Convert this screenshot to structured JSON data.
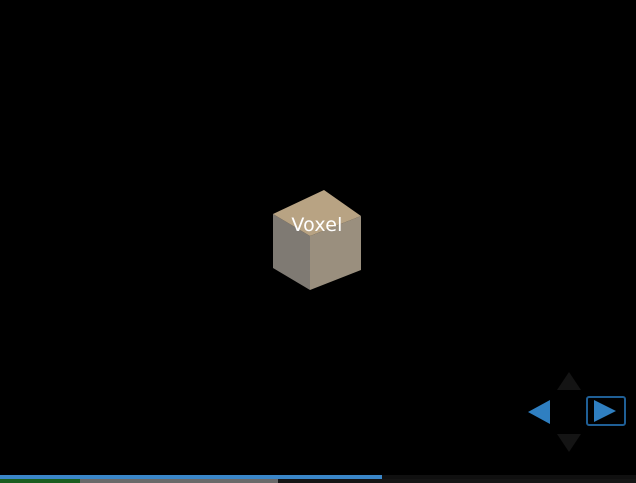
{
  "scene": {
    "object_label": "Voxel",
    "colors": {
      "cube_top": "#b8a383",
      "cube_left": "#7f7a73",
      "cube_right": "#9a8f7e",
      "background": "#000000"
    }
  },
  "navigation": {
    "up_icon": "arrow-up-icon",
    "down_icon": "arrow-down-icon",
    "left_icon": "arrow-left-icon",
    "right_icon": "arrow-right-icon",
    "accent": "#2f7fc1"
  },
  "progress": {
    "fraction": 0.6
  }
}
